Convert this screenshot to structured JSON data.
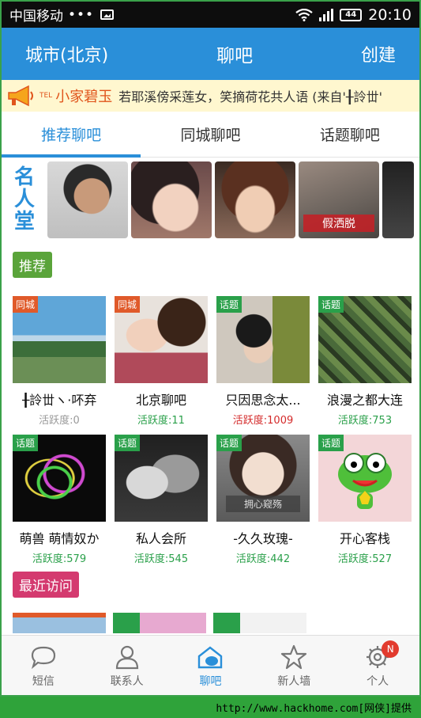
{
  "status_bar": {
    "carrier": "中国移动",
    "dots": "•••",
    "battery": "44",
    "time": "20:10"
  },
  "header": {
    "left": "城市(北京)",
    "title": "聊吧",
    "right": "创建"
  },
  "marquee": {
    "tel": "TEL",
    "name": "小家碧玉",
    "message": "若耶溪傍采莲女，笑摘荷花共人语 (来自'╂詅丗'"
  },
  "tabs": [
    {
      "label": "推荐聊吧"
    },
    {
      "label": "同城聊吧"
    },
    {
      "label": "话题聊吧"
    }
  ],
  "fame": {
    "label_chars": [
      "名",
      "人",
      "堂"
    ],
    "photo4_banner": "假洒脱"
  },
  "recommend_label": "推荐",
  "recent_label": "最近访问",
  "rooms": [
    {
      "badge": "同城",
      "name": "╂詅丗ヽ·吥弃",
      "activity": "活跃度:0"
    },
    {
      "badge": "同城",
      "name": "北京聊吧",
      "activity": "活跃度:11"
    },
    {
      "badge": "话题",
      "name": "只因思念太...",
      "activity": "活跃度:1009"
    },
    {
      "badge": "话题",
      "name": "浪漫之都大连",
      "activity": "活跃度:753"
    },
    {
      "badge": "话题",
      "name": "萌兽  萌情奴か",
      "activity": "活跃度:579"
    },
    {
      "badge": "话题",
      "name": "私人会所",
      "activity": "活跃度:545"
    },
    {
      "badge": "话题",
      "name": "-久久玫瑰-",
      "activity": "活跃度:442"
    },
    {
      "badge": "话题",
      "name": "开心客栈",
      "activity": "活跃度:527"
    }
  ],
  "room_overlay_text": "拥心窥殇",
  "bottom_nav": [
    {
      "label": "短信",
      "icon": "message-icon"
    },
    {
      "label": "联系人",
      "icon": "contact-icon"
    },
    {
      "label": "聊吧",
      "icon": "chat-home-icon"
    },
    {
      "label": "新人墙",
      "icon": "star-icon"
    },
    {
      "label": "个人",
      "icon": "gear-icon",
      "badge": "N"
    }
  ],
  "footer": "http://www.hackhome.com[网侠]提供",
  "colors": {
    "primary": "#2a8fd9",
    "green": "#2aa04a",
    "orange": "#e05a2a",
    "pink": "#d43a6f",
    "marquee_bg": "#fff7cf"
  }
}
